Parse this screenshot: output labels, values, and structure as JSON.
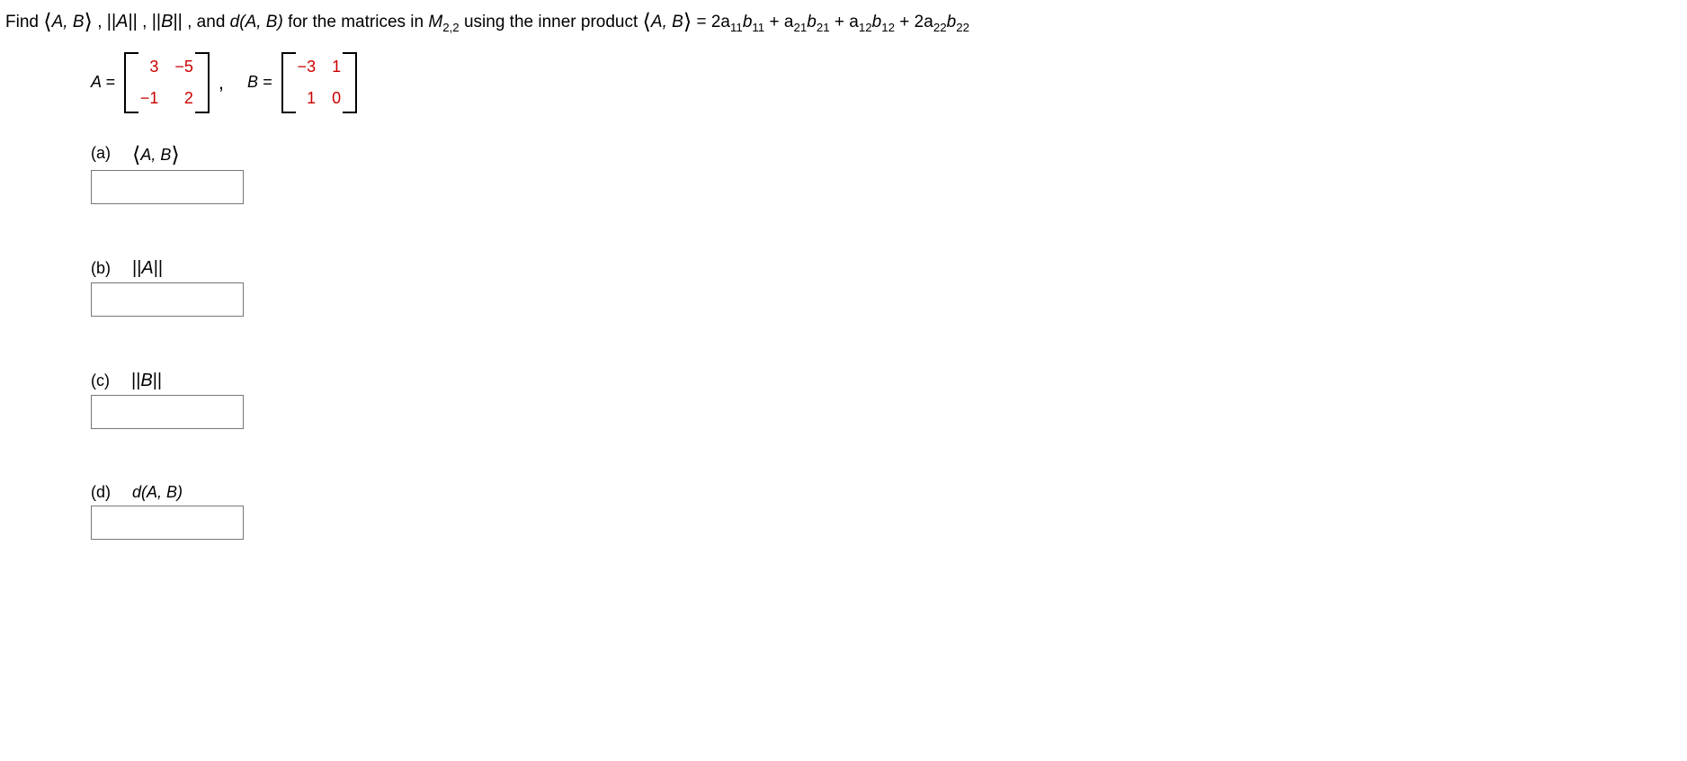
{
  "prompt": {
    "pre": "Find   ",
    "ab_open": "⟨",
    "ab_inner": "A, B",
    "ab_close": "⟩",
    "sep1": " ,  ",
    "normA": "||A||",
    "sep2": " ,  ",
    "normB": "||B||",
    "sep3": " , and ",
    "dAB": "d(A, B)",
    "mid": "  for the matrices in  ",
    "space": "M",
    "space_sub": "2,2",
    "using": "  using the inner product   ",
    "rhs_open": "⟨",
    "rhs_inner": "A, B",
    "rhs_close": "⟩",
    "equals": "  =  2a",
    "s11a": "11",
    "b1": "b",
    "s11b": "11",
    "plus1": " + a",
    "s21a": "21",
    "b2": "b",
    "s21b": "21",
    "plus2": " + a",
    "s12a": "12",
    "b3": "b",
    "s12b": "12",
    "plus3": " + 2a",
    "s22a": "22",
    "b4": "b",
    "s22b": "22"
  },
  "matrices": {
    "A_label": "A = ",
    "A": {
      "r1c1": "3",
      "r1c2": "−5",
      "r2c1": "−1",
      "r2c2": "2"
    },
    "comma": ",",
    "B_label": "B = ",
    "B": {
      "r1c1": "−3",
      "r1c2": "1",
      "r2c1": "1",
      "r2c2": "0"
    }
  },
  "parts": {
    "a": {
      "letter": "(a)",
      "label_open": "⟨",
      "label_inner": "A, B",
      "label_close": "⟩"
    },
    "b": {
      "letter": "(b)",
      "label": "||A||"
    },
    "c": {
      "letter": "(c)",
      "label": "||B||"
    },
    "d": {
      "letter": "(d)",
      "label": "d(A, B)"
    }
  }
}
